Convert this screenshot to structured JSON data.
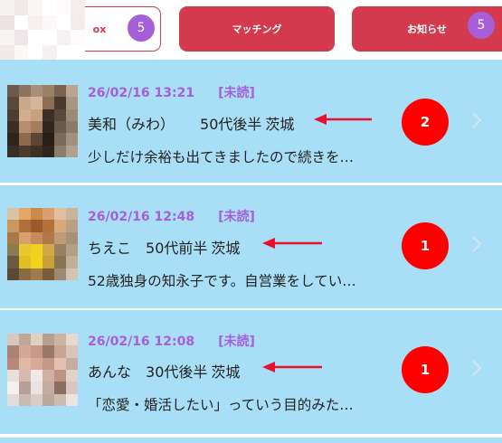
{
  "tabs": {
    "inbox": {
      "label": "ox",
      "badge": "5"
    },
    "matching": {
      "label": "マッチング"
    },
    "notice": {
      "label": "お知らせ",
      "badge": "5"
    }
  },
  "messages": [
    {
      "date": "26/02/16 13:21",
      "status": "[未読]",
      "name": "美和（みわ）",
      "age": "50代後半",
      "pref": "茨城",
      "preview": "少しだけ余裕も出てきましたので続きを…",
      "unread_count": "2"
    },
    {
      "date": "26/02/16 12:48",
      "status": "[未読]",
      "name": "ちえこ",
      "age": "50代前半",
      "pref": "茨城",
      "preview": "52歳独身の知永子です。自営業をしてい…",
      "unread_count": "1"
    },
    {
      "date": "26/02/16 12:08",
      "status": "[未読]",
      "name": "あんな",
      "age": "30代後半",
      "pref": "茨城",
      "preview": "「恋愛・婚活したい」っていう目的みた…",
      "unread_count": "1"
    }
  ],
  "colors": {
    "tab_red": "#d33a4e",
    "badge_purple": "#a65fd8",
    "row_bg": "#a8dff7",
    "count_red": "#ff0000",
    "arrow_red": "#e8102a"
  },
  "icons": {
    "chevron": "chevron-right-icon",
    "arrow": "left-arrow-icon"
  }
}
